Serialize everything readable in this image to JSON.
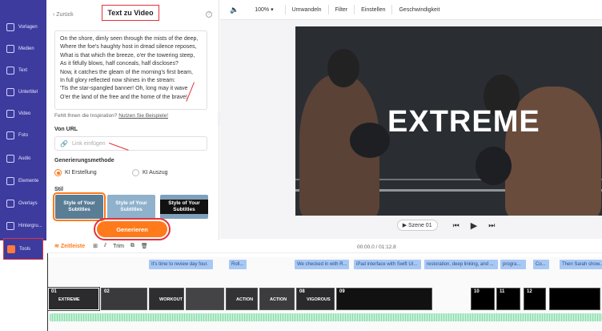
{
  "sidebar": {
    "items": [
      {
        "label": "Vorlagen"
      },
      {
        "label": "Medien"
      },
      {
        "label": "Text"
      },
      {
        "label": "Untertitel"
      },
      {
        "label": "Video"
      },
      {
        "label": "Foto"
      },
      {
        "label": "Audio"
      },
      {
        "label": "Elemente"
      },
      {
        "label": "Overlays"
      },
      {
        "label": "Hintergru..."
      },
      {
        "label": "Tools"
      }
    ]
  },
  "panel": {
    "back": "Zurück",
    "title": "Text zu Video",
    "help": "?",
    "text": "On the shore, dimly seen through the mists of the deep,\nWhere the foe's haughty host in dread silence reposes,\nWhat is that which the breeze, o'er the towering steep,\nAs it fitfully blows, half conceals, half discloses?\nNow, it catches the gleam of the morning's first beam,\nIn full glory reflected now shines in the stream:\n'Tis the star-spangled banner! Oh, long may it wave\nO'er the land of the free and the home of the brave!",
    "inspire_prefix": "Fehlt Ihnen die Inspiration?",
    "inspire_link": "Nutzen Sie Beispiele!",
    "url_label": "Von URL",
    "url_placeholder": "Link einfügen",
    "method_label": "Generierungsmethode",
    "method_options": [
      "KI Erstellung",
      "KI Auszug"
    ],
    "style_label": "Stil",
    "style_cards": [
      "Style of Your Subtitles",
      "Style of Your Subtitles",
      "Style of Your Subtitles"
    ],
    "generate": "Generieren"
  },
  "toolbar": {
    "zoom": "100%",
    "items": [
      "Umwandeln",
      "Filter",
      "Einstellen",
      "Geschwindigkeit"
    ]
  },
  "preview": {
    "overlay": "EXTREME",
    "scene": "Szene 01"
  },
  "timeline": {
    "tab": "Zeitleiste",
    "trim": "Trim",
    "time": "00:00.0 / 01:12.8",
    "subtitles": [
      "It's time to review day four.",
      "Roll...",
      "We checked in with R...",
      "iPad interface with Swift UI...",
      "restoration, deep linking, and ...",
      "progra...",
      "Co...",
      "Then Sarah show..."
    ],
    "clips": [
      {
        "num": "01",
        "cap": "EXTREME"
      },
      {
        "num": "02",
        "cap": ""
      },
      {
        "num": "",
        "cap": "WORKOUT"
      },
      {
        "num": "",
        "cap": ""
      },
      {
        "num": "",
        "cap": "ACTION"
      },
      {
        "num": "",
        "cap": "ACTION"
      },
      {
        "num": "08",
        "cap": "VIGOROUS"
      },
      {
        "num": "09",
        "cap": ""
      },
      {
        "num": "10",
        "cap": ""
      },
      {
        "num": "11",
        "cap": ""
      },
      {
        "num": "12",
        "cap": ""
      }
    ]
  },
  "colors": {
    "sidebar": "#3d3b9e",
    "accent": "#ff7a1a",
    "highlight": "#e5323b"
  }
}
